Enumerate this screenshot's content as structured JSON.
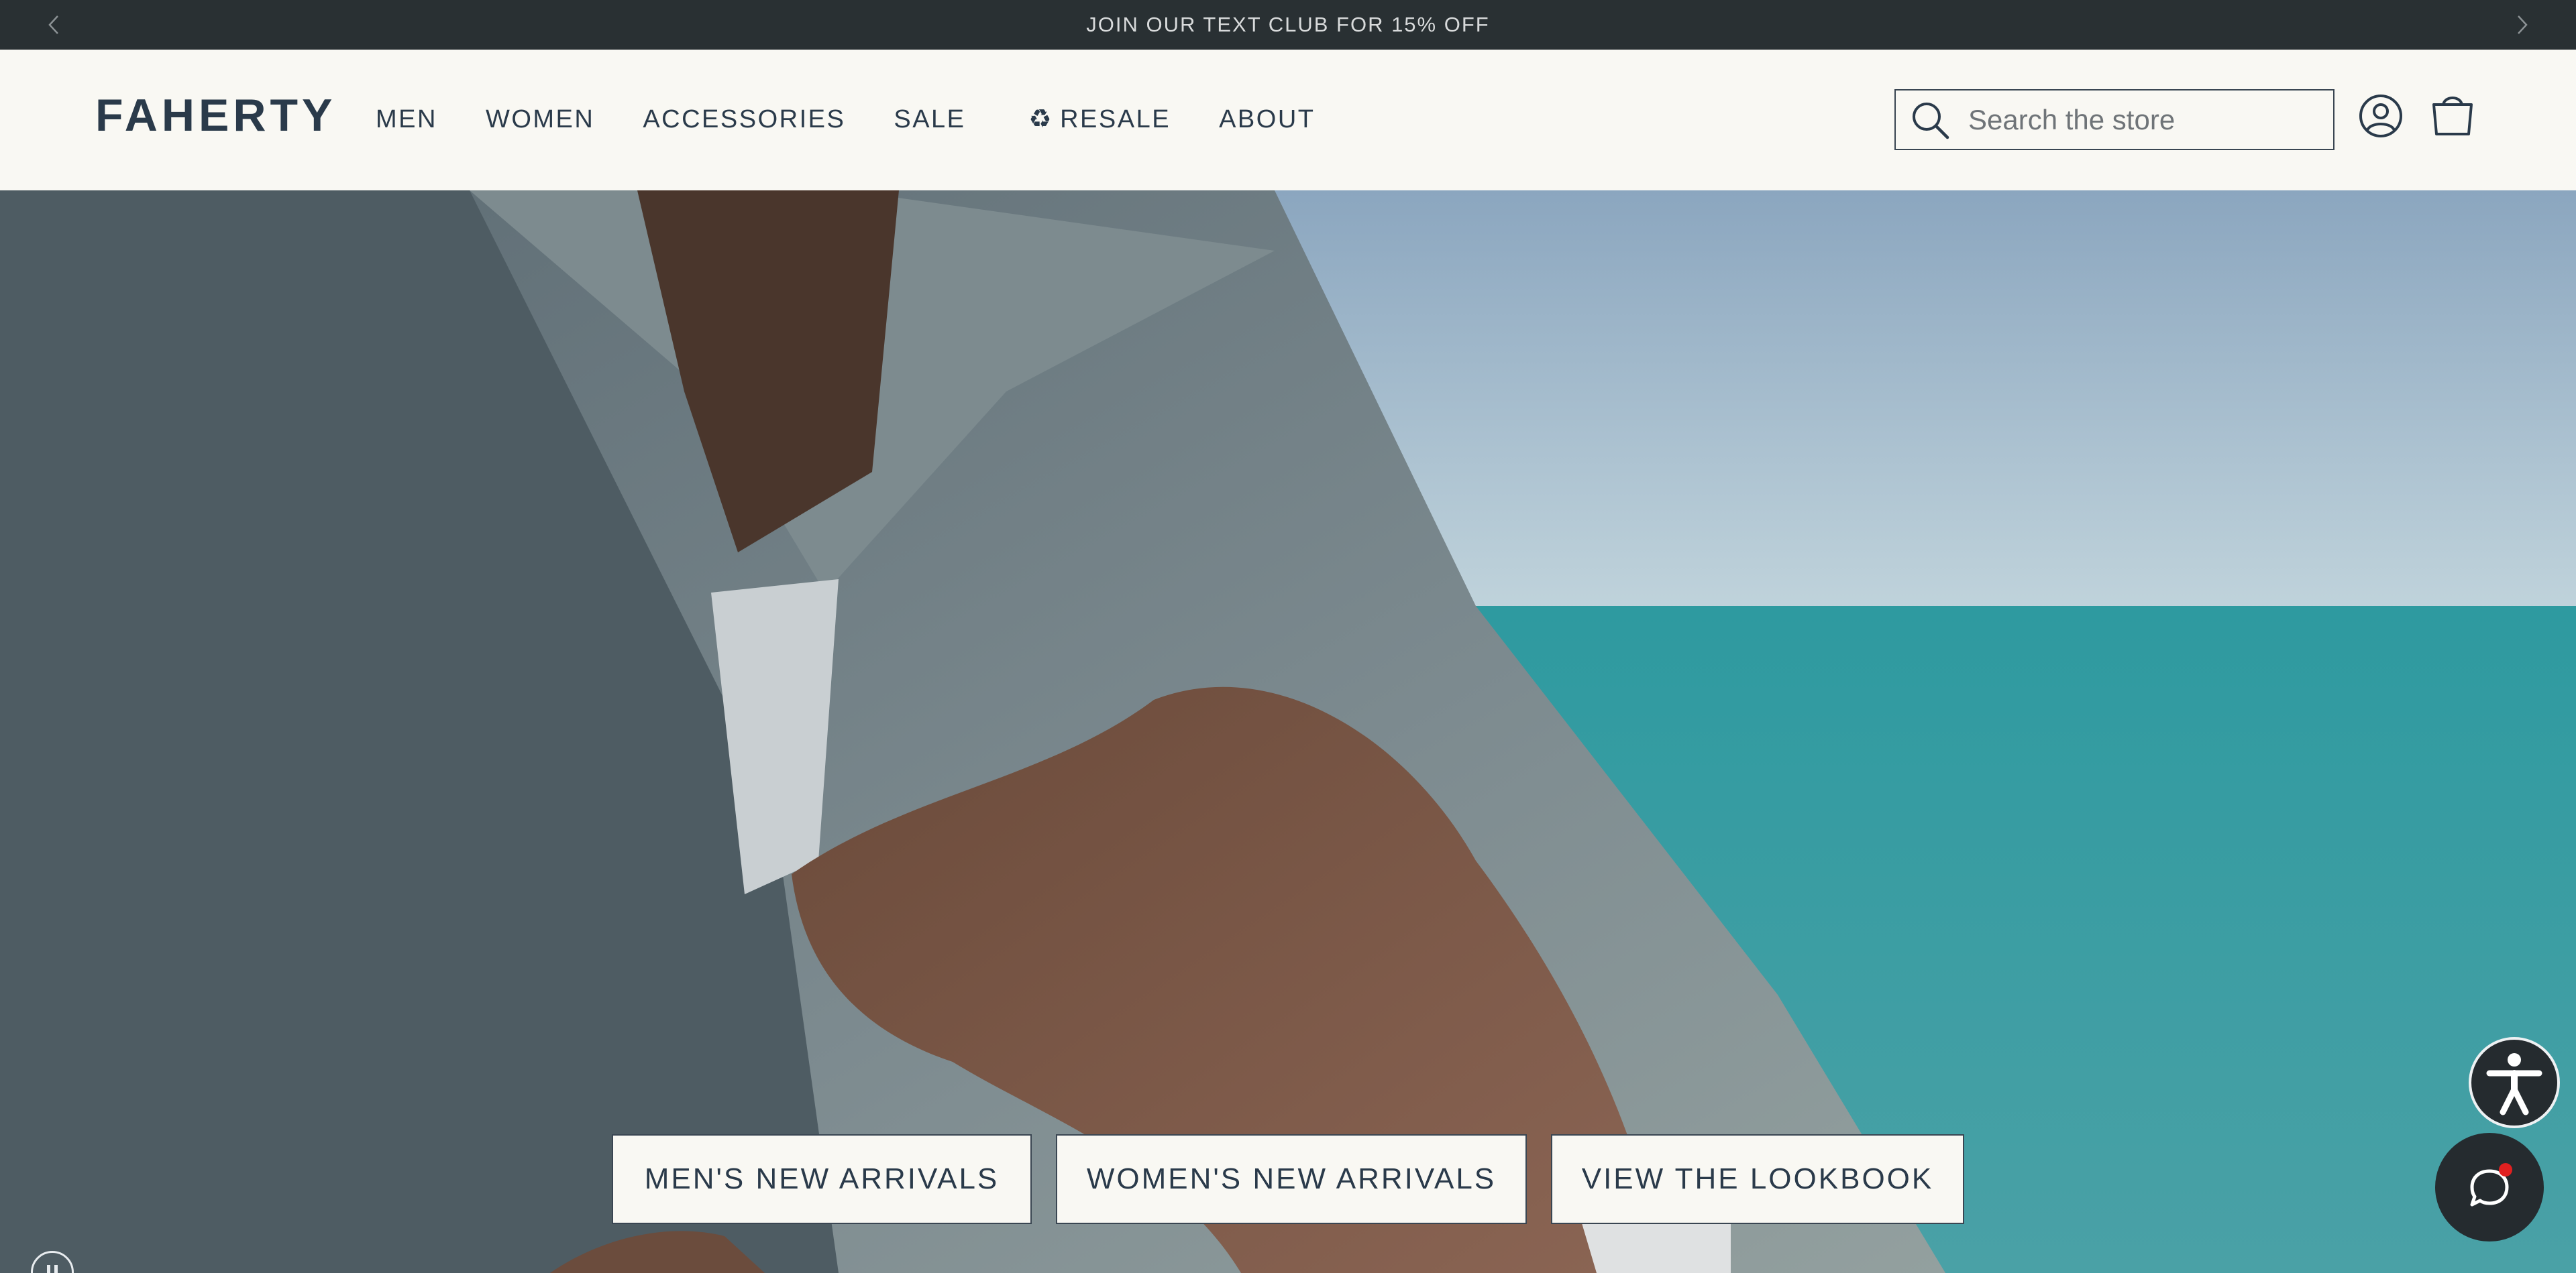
{
  "announcement": {
    "text": "JOIN OUR TEXT CLUB FOR 15% OFF",
    "prev_icon": "chevron-left-icon",
    "next_icon": "chevron-right-icon"
  },
  "header": {
    "logo": "FAHERTY",
    "nav": {
      "men": "MEN",
      "women": "WOMEN",
      "accessories": "ACCESSORIES",
      "sale": "SALE",
      "resale_icon": "♻",
      "resale": "RESALE",
      "about": "ABOUT"
    },
    "search": {
      "placeholder": "Search the store",
      "value": ""
    },
    "account_icon": "user-circle-icon",
    "cart_icon": "shopping-bag-icon"
  },
  "hero": {
    "ctas": {
      "mens": "MEN'S NEW ARRIVALS",
      "womens": "WOMEN'S NEW ARRIVALS",
      "lookbook": "VIEW THE LOOKBOOK"
    },
    "pause_icon": "pause-icon"
  },
  "widgets": {
    "accessibility_icon": "accessibility-icon",
    "chat_icon": "chat-bubble-icon",
    "notification_color": "#e02020"
  },
  "colors": {
    "announcement_bg": "#293033",
    "header_bg": "#f9f8f3",
    "text": "#2a3a4a"
  }
}
